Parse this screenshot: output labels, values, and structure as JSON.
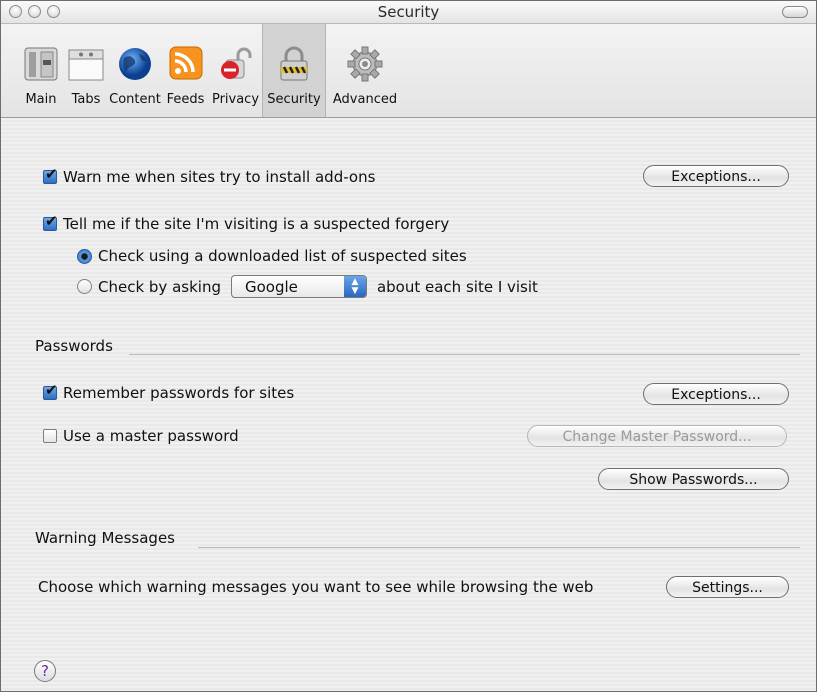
{
  "window": {
    "title": "Security"
  },
  "toolbar": {
    "items": [
      {
        "label": "Main",
        "icon": "main-switch-icon"
      },
      {
        "label": "Tabs",
        "icon": "tabs-icon"
      },
      {
        "label": "Content",
        "icon": "globe-icon"
      },
      {
        "label": "Feeds",
        "icon": "rss-feed-icon"
      },
      {
        "label": "Privacy",
        "icon": "privacy-lock-icon"
      },
      {
        "label": "Security",
        "icon": "security-padlock-icon",
        "active": true
      },
      {
        "label": "Advanced",
        "icon": "advanced-gear-icon"
      }
    ]
  },
  "security": {
    "warn_addons_label": "Warn me when sites try to install add-ons",
    "warn_addons_checked": true,
    "exceptions_label": "Exceptions...",
    "forgery_label": "Tell me if the site I'm visiting is a suspected forgery",
    "forgery_checked": true,
    "radio_download_label": "Check using a downloaded list of suspected sites",
    "radio_ask_label": "Check by asking",
    "provider_selected": "Google",
    "ask_suffix": "about each site I visit"
  },
  "passwords": {
    "section_label": "Passwords",
    "remember_label": "Remember passwords for sites",
    "remember_checked": true,
    "exceptions_label": "Exceptions...",
    "master_label": "Use a master password",
    "master_checked": false,
    "change_master_label": "Change Master Password...",
    "show_passwords_label": "Show Passwords..."
  },
  "warnings": {
    "section_label": "Warning Messages",
    "description": "Choose which warning messages you want to see while browsing the web",
    "settings_label": "Settings..."
  },
  "help": {
    "glyph": "?"
  },
  "colors": {
    "accent_blue": "#2f6ec4",
    "help_purple": "#6b2ea0"
  }
}
